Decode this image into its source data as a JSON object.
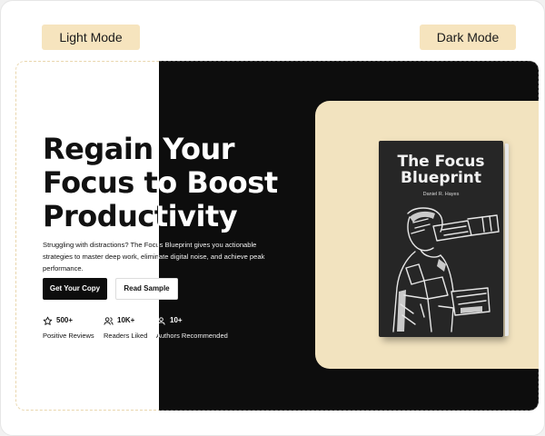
{
  "modes": {
    "light": "Light Mode",
    "dark": "Dark Mode"
  },
  "hero": {
    "headline_lines": [
      "Regain Your",
      "Focus to Boost",
      "Productivity"
    ],
    "description": "Struggling with distractions? The Focus Blueprint gives you actionable strategies to master deep work, eliminate digital noise, and achieve peak performance.",
    "primary_button": "Get Your Copy",
    "secondary_button": "Read Sample"
  },
  "stats": [
    {
      "icon": "star-icon",
      "value": "500+",
      "label": "Positive Reviews"
    },
    {
      "icon": "users-icon",
      "value": "10K+",
      "label": "Readers Liked"
    },
    {
      "icon": "user-icon",
      "value": "10+",
      "label": "Authors Recommended"
    }
  ],
  "book": {
    "title_lines": [
      "The Focus",
      "Blueprint"
    ],
    "author": "Daniel R. Hayes"
  },
  "colors": {
    "accent": "#f6e4be",
    "panel_cream": "#f2e3bf",
    "dark_bg": "#0d0d0d",
    "light_bg": "#ffffff"
  }
}
